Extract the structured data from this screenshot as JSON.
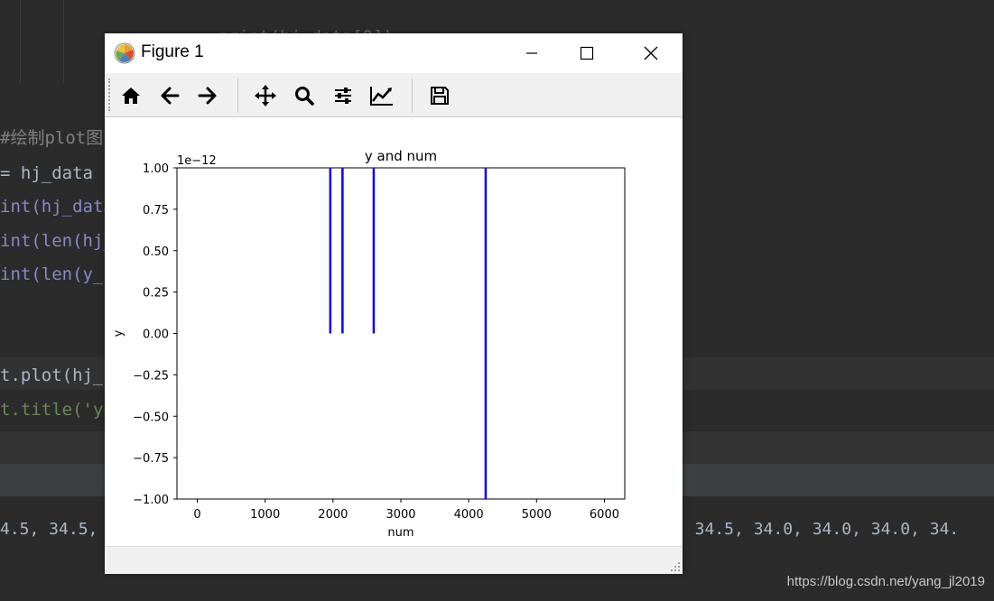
{
  "ide": {
    "code_lines": [
      {
        "text": "        print(hj_data[0])",
        "class": "faded"
      },
      {
        "text": "#绘制plot图",
        "class": "comment"
      },
      {
        "text": "= hj_data",
        "class": "plain"
      },
      {
        "text": "int(hj_data",
        "class": "call"
      },
      {
        "text": "int(len(hj_",
        "class": "call"
      },
      {
        "text": "int(len(y_",
        "class": "call"
      },
      {
        "text": "t.plot(hj_",
        "class": "plain"
      },
      {
        "text": "t.title('y",
        "class": "plain"
      }
    ],
    "console_left": "4.5, 34.5,",
    "console_right": ", 34.5, 34.0, 34.0, 34.0, 34.",
    "watermark": "https://blog.csdn.net/yang_jl2019"
  },
  "window": {
    "title": "Figure 1",
    "toolbar": [
      {
        "name": "home-icon",
        "tooltip": "Home"
      },
      {
        "name": "back-arrow-icon",
        "tooltip": "Back"
      },
      {
        "name": "forward-arrow-icon",
        "tooltip": "Forward"
      },
      {
        "name": "pan-icon",
        "tooltip": "Pan"
      },
      {
        "name": "zoom-icon",
        "tooltip": "Zoom"
      },
      {
        "name": "configure-subplots-icon",
        "tooltip": "Subplots"
      },
      {
        "name": "edit-axis-icon",
        "tooltip": "Customize"
      },
      {
        "name": "save-icon",
        "tooltip": "Save"
      }
    ]
  },
  "chart_data": {
    "type": "line",
    "title": "y and num",
    "xlabel": "num",
    "ylabel": "y",
    "offset_label": "1e−12",
    "xlim": [
      -300,
      6300
    ],
    "ylim": [
      -1.0,
      1.0
    ],
    "x_ticks": [
      0,
      1000,
      2000,
      3000,
      4000,
      5000,
      6000
    ],
    "y_ticks": [
      1.0,
      0.75,
      0.5,
      0.25,
      0.0,
      -0.25,
      -0.5,
      -0.75,
      -1.0
    ],
    "x_tick_labels": [
      "0",
      "1000",
      "2000",
      "3000",
      "4000",
      "5000",
      "6000"
    ],
    "y_tick_labels": [
      "1.00",
      "0.75",
      "0.50",
      "0.25",
      "0.00",
      "−0.25",
      "−0.50",
      "−0.75",
      "−1.00"
    ],
    "grid": false,
    "line_color": "#0000ff",
    "series": [
      {
        "segments": [
          {
            "x": [
              1960,
              1960
            ],
            "y": [
              0.0,
              1.0
            ]
          },
          {
            "x": [
              2140,
              2140
            ],
            "y": [
              0.0,
              1.0
            ]
          },
          {
            "x": [
              2600,
              2600
            ],
            "y": [
              0.0,
              1.0
            ]
          },
          {
            "x": [
              4250,
              4250
            ],
            "y": [
              -1.0,
              1.0
            ]
          }
        ]
      }
    ]
  }
}
